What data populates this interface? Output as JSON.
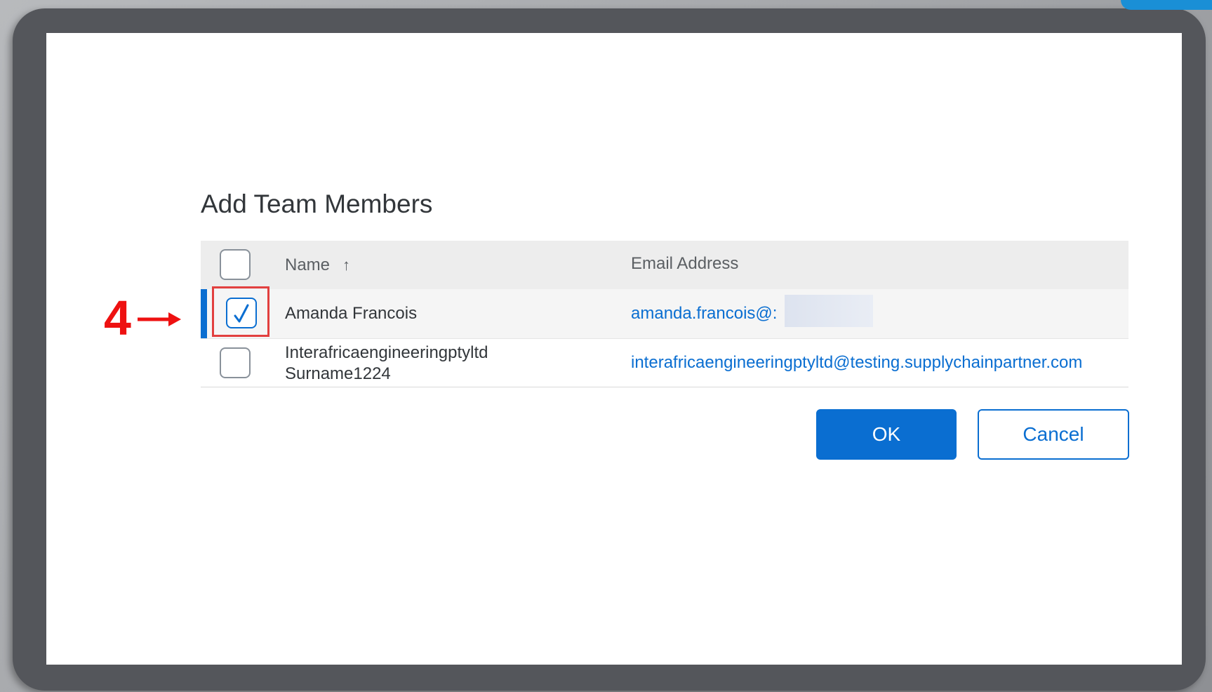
{
  "dialog": {
    "title": "Add Team Members"
  },
  "table": {
    "columns": {
      "name": "Name",
      "email": "Email Address"
    },
    "rows": [
      {
        "name": "Amanda Francois",
        "email": "amanda.francois@:",
        "selected": true
      },
      {
        "name_line1": "Interafricaengineeringptyltd",
        "name_line2": "Surname1224",
        "email": "interafricaengineeringptyltd@testing.supplychainpartner.com",
        "selected": false
      }
    ]
  },
  "buttons": {
    "ok": "OK",
    "cancel": "Cancel"
  },
  "annotation": {
    "step": "4"
  },
  "colors": {
    "accent": "#0a6ed1",
    "annotation": "#ee1111",
    "frame": "#54565b"
  },
  "icons": {
    "sort": "sort-ascending-icon",
    "check": "checkmark-icon",
    "arrow": "arrow-right-icon"
  }
}
